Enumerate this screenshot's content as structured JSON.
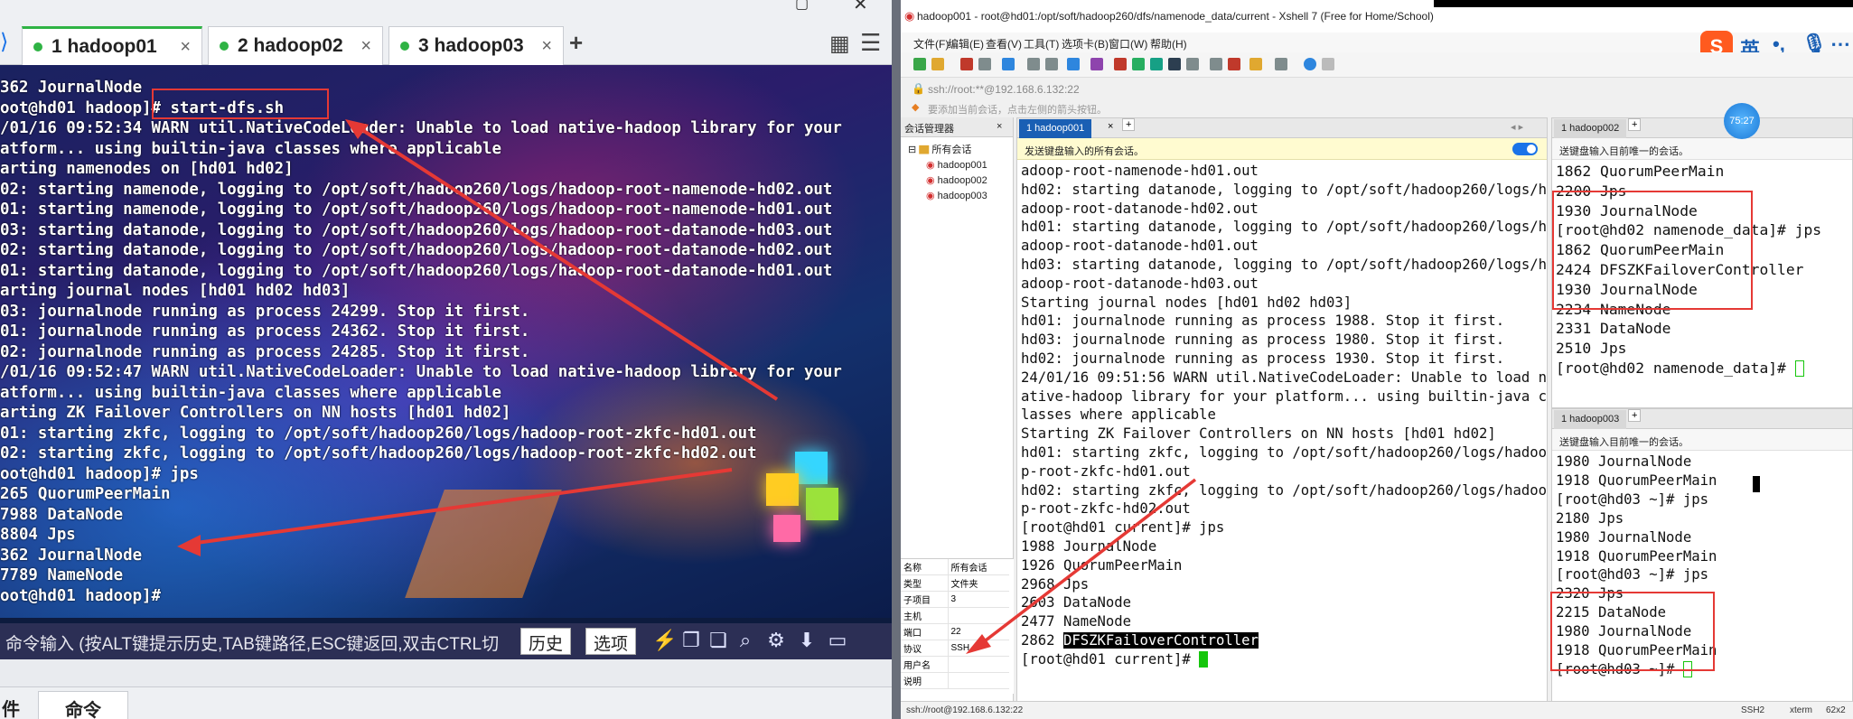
{
  "left": {
    "tabs": [
      {
        "num": "1",
        "label": "hadoop01"
      },
      {
        "num": "2",
        "label": "hadoop02"
      },
      {
        "num": "3",
        "label": "hadoop03"
      }
    ],
    "tab_close": "×",
    "add_tab": "+",
    "terminal_text": "362 JournalNode\noot@hd01 hadoop]# start-dfs.sh\n/01/16 09:52:34 WARN util.NativeCodeLoader: Unable to load native-hadoop library for your\natform... using builtin-java classes where applicable\narting namenodes on [hd01 hd02]\n02: starting namenode, logging to /opt/soft/hadoop260/logs/hadoop-root-namenode-hd02.out\n01: starting namenode, logging to /opt/soft/hadoop260/logs/hadoop-root-namenode-hd01.out\n03: starting datanode, logging to /opt/soft/hadoop260/logs/hadoop-root-datanode-hd03.out\n02: starting datanode, logging to /opt/soft/hadoop260/logs/hadoop-root-datanode-hd02.out\n01: starting datanode, logging to /opt/soft/hadoop260/logs/hadoop-root-datanode-hd01.out\narting journal nodes [hd01 hd02 hd03]\n03: journalnode running as process 24299. Stop it first.\n01: journalnode running as process 24362. Stop it first.\n02: journalnode running as process 24285. Stop it first.\n/01/16 09:52:47 WARN util.NativeCodeLoader: Unable to load native-hadoop library for your\natform... using builtin-java classes where applicable\narting ZK Failover Controllers on NN hosts [hd01 hd02]\n01: starting zkfc, logging to /opt/soft/hadoop260/logs/hadoop-root-zkfc-hd01.out\n02: starting zkfc, logging to /opt/soft/hadoop260/logs/hadoop-root-zkfc-hd02.out\noot@hd01 hadoop]# jps\n265 QuorumPeerMain\n7988 DataNode\n8804 Jps\n362 JournalNode\n7789 NameNode\noot@hd01 hadoop]#",
    "command_placeholder": "命令输入 (按ALT键提示历史,TAB键路径,ESC键返回,双击CTRL切",
    "history_button": "历史",
    "options_button": "选项",
    "bottom_tabs": [
      "件",
      "命令"
    ]
  },
  "right": {
    "window_title": "hadoop001 - root@hd01:/opt/soft/hadoop260/dfs/namenode_data/current - Xshell 7 (Free for Home/School)",
    "menu": [
      "文件(F)",
      "编辑(E)",
      "查看(V)",
      "工具(T)",
      "选项卡(B)",
      "窗口(W)",
      "帮助(H)"
    ],
    "address": "ssh://root:**@192.168.6.132:22",
    "tip": "要添加当前会话，点击左侧的箭头按钮。",
    "session_manager": {
      "title": "会话管理器",
      "root": "所有会话",
      "items": [
        "hadoop001",
        "hadoop002",
        "hadoop003"
      ]
    },
    "properties": [
      [
        "名称",
        "所有会话"
      ],
      [
        "类型",
        "文件夹"
      ],
      [
        "子项目",
        "3"
      ],
      [
        "主机",
        ""
      ],
      [
        "端口",
        "22"
      ],
      [
        "协议",
        "SSH"
      ],
      [
        "用户名",
        ""
      ],
      [
        "说明",
        ""
      ]
    ],
    "main_tab": "1 hadoop001",
    "main_send_bar": "发送键盘输入的所有会话。",
    "main_terminal_lines": [
      "adoop-root-namenode-hd01.out",
      "hd02: starting datanode, logging to /opt/soft/hadoop260/logs/h",
      "adoop-root-datanode-hd02.out",
      "hd01: starting datanode, logging to /opt/soft/hadoop260/logs/h",
      "adoop-root-datanode-hd01.out",
      "hd03: starting datanode, logging to /opt/soft/hadoop260/logs/h",
      "adoop-root-datanode-hd03.out",
      "Starting journal nodes [hd01 hd02 hd03]",
      "hd01: journalnode running as process 1988. Stop it first.",
      "hd03: journalnode running as process 1980. Stop it first.",
      "hd02: journalnode running as process 1930. Stop it first.",
      "24/01/16 09:51:56 WARN util.NativeCodeLoader: Unable to load n",
      "ative-hadoop library for your platform... using builtin-java c",
      "lasses where applicable",
      "Starting ZK Failover Controllers on NN hosts [hd01 hd02]",
      "hd01: starting zkfc, logging to /opt/soft/hadoop260/logs/hadoo",
      "p-root-zkfc-hd01.out",
      "hd02: starting zkfc, logging to /opt/soft/hadoop260/logs/hadoo",
      "p-root-zkfc-hd02.out",
      "[root@hd01 current]# jps",
      "1988 JournalNode",
      "1926 QuorumPeerMain",
      "2968 Jps",
      "2603 DataNode",
      "2477 NameNode"
    ],
    "main_selected_prefix": "2862 ",
    "main_selected_word": "DFSZKFailoverController",
    "main_prompt": "[root@hd01 current]# ",
    "pane2_tab": "1 hadoop002",
    "pane2_send_bar": "送键盘输入目前唯一的会话。",
    "pane2_terminal": "1862 QuorumPeerMain\n2200 Jps\n1930 JournalNode\n[root@hd02 namenode_data]# jps\n1862 QuorumPeerMain\n2424 DFSZKFailoverController\n1930 JournalNode\n2234 NameNode\n2331 DataNode\n2510 Jps\n[root@hd02 namenode_data]# ",
    "pane3_tab": "1 hadoop003",
    "pane3_send_bar": "送键盘输入目前唯一的会话。",
    "pane3_terminal": "1980 JournalNode\n1918 QuorumPeerMain\n[root@hd03 ~]# jps\n2180 Jps\n1980 JournalNode\n1918 QuorumPeerMain\n[root@hd03 ~]# jps\n2320 Jps\n2215 DataNode\n1980 JournalNode\n1918 QuorumPeerMain\n[root@hd03 ~]# ",
    "status_left": "ssh://root@192.168.6.132:22",
    "status_items": [
      "SSH2",
      "xterm",
      "62x2"
    ],
    "ime_label": "英",
    "clock": "75:27"
  }
}
